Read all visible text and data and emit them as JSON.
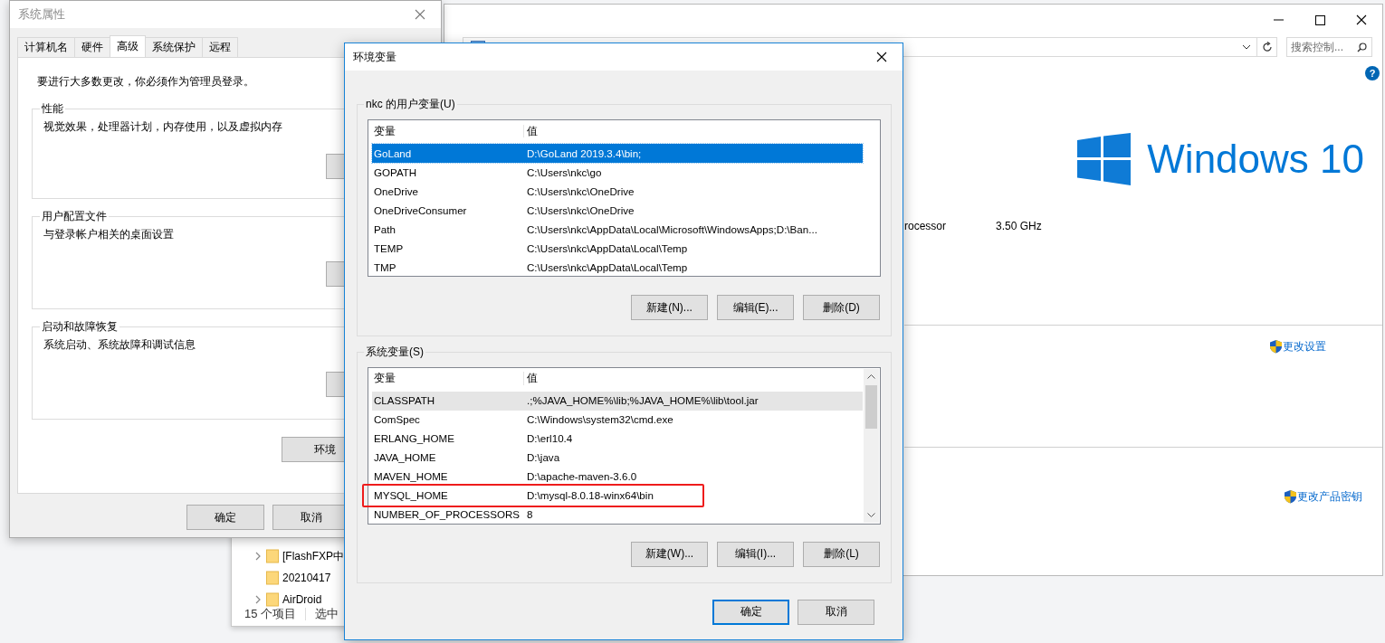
{
  "control_panel": {
    "search": {
      "placeholder": "搜索控制..."
    },
    "help": "?",
    "logo_text": "Windows 10",
    "processor": {
      "label": "rocessor",
      "value": "3.50 GHz"
    },
    "links": [
      {
        "label": "更改设置"
      },
      {
        "label": "更改产品密钥"
      }
    ]
  },
  "explorer": {
    "items": [
      {
        "name": "[FlashFXP中",
        "expandable": true
      },
      {
        "name": "20210417",
        "expandable": false
      },
      {
        "name": "AirDroid",
        "expandable": true
      }
    ],
    "status": [
      "15 个项目",
      "选中"
    ]
  },
  "system_properties": {
    "title": "系统属性",
    "active": false,
    "tabs": [
      {
        "label": "计算机名",
        "selected": false
      },
      {
        "label": "硬件",
        "selected": false
      },
      {
        "label": "高级",
        "selected": true
      },
      {
        "label": "系统保护",
        "selected": false
      },
      {
        "label": "远程",
        "selected": false
      }
    ],
    "notice": "要进行大多数更改，你必须作为管理员登录。",
    "groups": [
      {
        "title": "性能",
        "description": "视觉效果，处理器计划，内存使用，以及虚拟内存"
      },
      {
        "title": "用户配置文件",
        "description": "与登录帐户相关的桌面设置"
      },
      {
        "title": "启动和故障恢复",
        "description": "系统启动、系统故障和调试信息"
      }
    ],
    "env_button": "环境",
    "buttons": [
      "确定",
      "取消"
    ]
  },
  "env_dialog": {
    "title": "环境变量",
    "user_group": {
      "title": "nkc 的用户变量(U)",
      "columns": [
        "变量",
        "值"
      ],
      "rows": [
        {
          "name": "GoLand",
          "value": "D:\\GoLand 2019.3.4\\bin;",
          "selected": true,
          "hovered": false,
          "marked": false
        },
        {
          "name": "GOPATH",
          "value": "C:\\Users\\nkc\\go",
          "selected": false,
          "hovered": false,
          "marked": false
        },
        {
          "name": "OneDrive",
          "value": "C:\\Users\\nkc\\OneDrive",
          "selected": false,
          "hovered": false,
          "marked": false
        },
        {
          "name": "OneDriveConsumer",
          "value": "C:\\Users\\nkc\\OneDrive",
          "selected": false,
          "hovered": false,
          "marked": false
        },
        {
          "name": "Path",
          "value": "C:\\Users\\nkc\\AppData\\Local\\Microsoft\\WindowsApps;D:\\Ban...",
          "selected": false,
          "hovered": false,
          "marked": false
        },
        {
          "name": "TEMP",
          "value": "C:\\Users\\nkc\\AppData\\Local\\Temp",
          "selected": false,
          "hovered": false,
          "marked": false
        },
        {
          "name": "TMP",
          "value": "C:\\Users\\nkc\\AppData\\Local\\Temp",
          "selected": false,
          "hovered": false,
          "marked": false
        }
      ],
      "buttons": [
        "新建(N)...",
        "编辑(E)...",
        "删除(D)"
      ]
    },
    "system_group": {
      "title": "系统变量(S)",
      "columns": [
        "变量",
        "值"
      ],
      "rows": [
        {
          "name": "CLASSPATH",
          "value": ".;%JAVA_HOME%\\lib;%JAVA_HOME%\\lib\\tool.jar",
          "selected": false,
          "hovered": true,
          "marked": false
        },
        {
          "name": "ComSpec",
          "value": "C:\\Windows\\system32\\cmd.exe",
          "selected": false,
          "hovered": false,
          "marked": false
        },
        {
          "name": "ERLANG_HOME",
          "value": "D:\\erl10.4",
          "selected": false,
          "hovered": false,
          "marked": false
        },
        {
          "name": "JAVA_HOME",
          "value": "D:\\java",
          "selected": false,
          "hovered": false,
          "marked": false
        },
        {
          "name": "MAVEN_HOME",
          "value": "D:\\apache-maven-3.6.0",
          "selected": false,
          "hovered": false,
          "marked": false
        },
        {
          "name": "MYSQL_HOME",
          "value": "D:\\mysql-8.0.18-winx64\\bin",
          "selected": false,
          "hovered": false,
          "marked": true
        },
        {
          "name": "NUMBER_OF_PROCESSORS",
          "value": "8",
          "selected": false,
          "hovered": false,
          "marked": false
        }
      ],
      "buttons": [
        "新建(W)...",
        "编辑(I)...",
        "删除(L)"
      ]
    },
    "buttons": [
      {
        "label": "确定",
        "default": true
      },
      {
        "label": "取消",
        "default": false
      }
    ]
  }
}
